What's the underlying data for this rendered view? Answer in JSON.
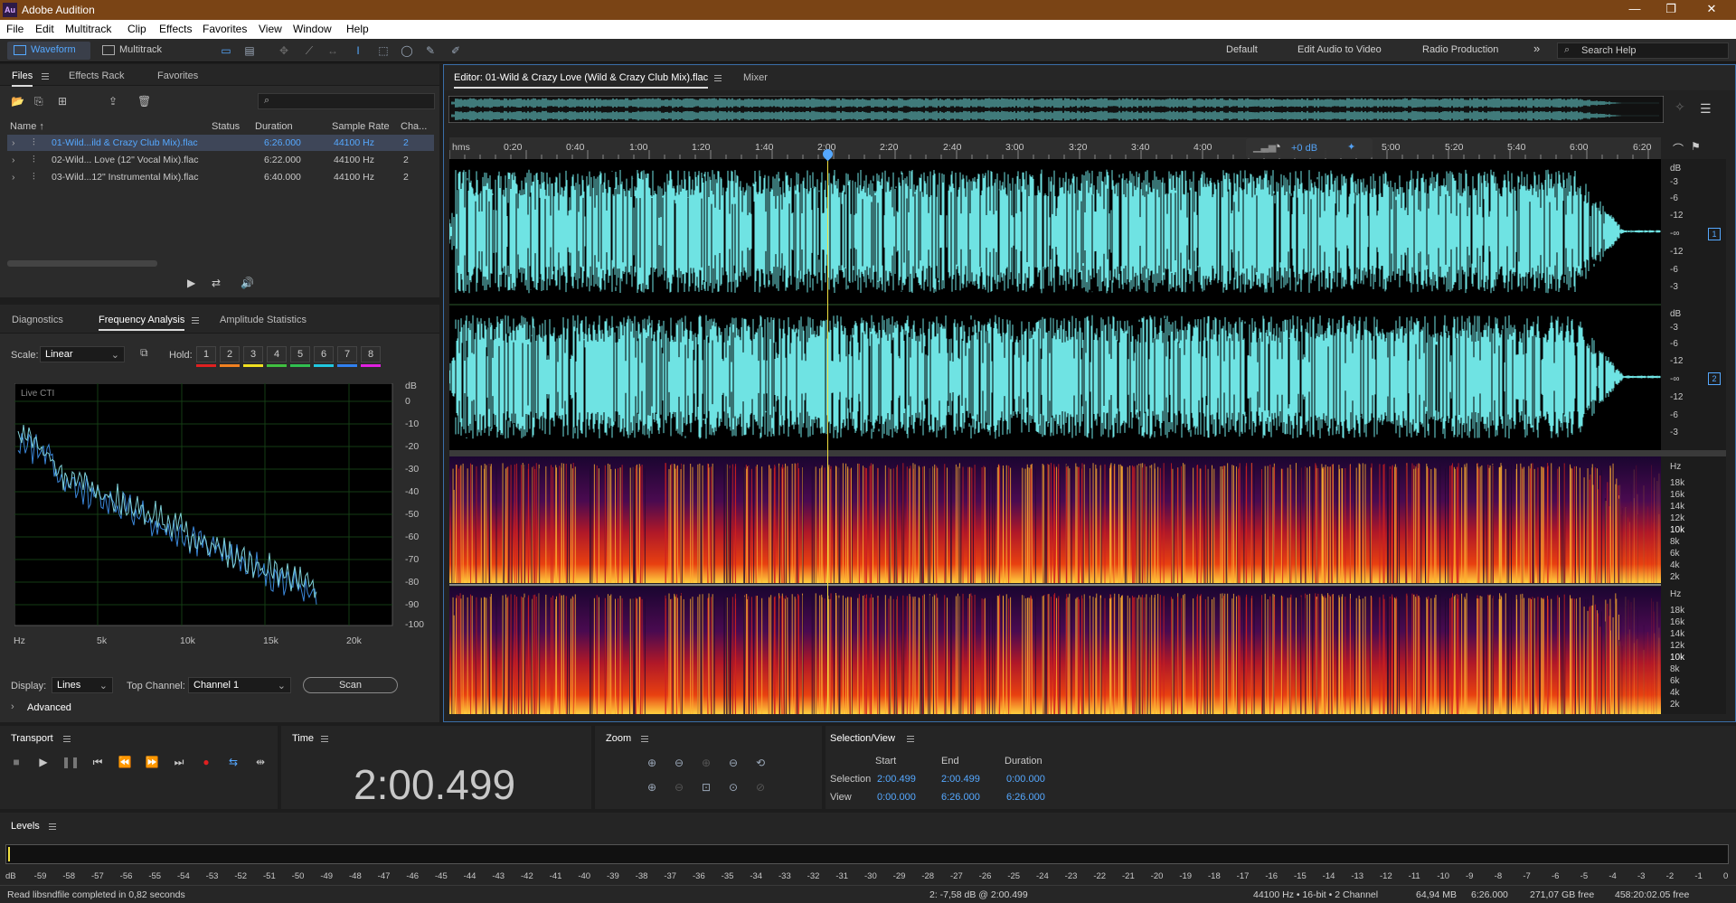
{
  "app": {
    "title": "Adobe Audition",
    "logo": "Au"
  },
  "window_controls": [
    "—",
    "❐",
    "✕"
  ],
  "menu": [
    "File",
    "Edit",
    "Multitrack",
    "Clip",
    "Effects",
    "Favorites",
    "View",
    "Window",
    "Help"
  ],
  "toolbar": {
    "modes": [
      "Waveform",
      "Multitrack"
    ],
    "workspaces": [
      "Default",
      "Edit Audio to Video",
      "Radio Production"
    ],
    "more": "»",
    "search_placeholder": "Search Help"
  },
  "files_panel": {
    "tabs": [
      "Files",
      "Effects Rack",
      "Favorites"
    ],
    "columns": [
      "Name ↑",
      "Status",
      "Duration",
      "Sample Rate",
      "Cha..."
    ],
    "rows": [
      {
        "name": "01-Wild...ild & Crazy Club Mix).flac",
        "duration": "6:26.000",
        "rate": "44100 Hz",
        "ch": "2",
        "selected": true
      },
      {
        "name": "02-Wild... Love (12\" Vocal Mix).flac",
        "duration": "6:22.000",
        "rate": "44100 Hz",
        "ch": "2",
        "selected": false
      },
      {
        "name": "03-Wild...12\" Instrumental Mix).flac",
        "duration": "6:40.000",
        "rate": "44100 Hz",
        "ch": "2",
        "selected": false
      }
    ]
  },
  "analysis_panel": {
    "tabs": [
      "Diagnostics",
      "Frequency Analysis",
      "Amplitude Statistics"
    ],
    "scale_label": "Scale:",
    "scale_value": "Linear",
    "hold_label": "Hold:",
    "hold_buttons": [
      "1",
      "2",
      "3",
      "4",
      "5",
      "6",
      "7",
      "8"
    ],
    "hold_colors": [
      "#e02020",
      "#f08020",
      "#f0e020",
      "#40c040",
      "#30c050",
      "#20c8e0",
      "#3080f0",
      "#e020e0"
    ],
    "graph_label": "Live CTI",
    "db_unit": "dB",
    "db_ticks": [
      "0",
      "-10",
      "-20",
      "-30",
      "-40",
      "-50",
      "-60",
      "-70",
      "-80",
      "-90",
      "-100"
    ],
    "freq_ticks": [
      "Hz",
      "5k",
      "10k",
      "15k",
      "20k"
    ],
    "display_label": "Display:",
    "display_value": "Lines",
    "top_channel_label": "Top Channel:",
    "top_channel_value": "Channel 1",
    "scan_label": "Scan",
    "advanced_label": "Advanced"
  },
  "editor": {
    "tab_title": "Editor: 01-Wild & Crazy Love (Wild & Crazy Club Mix).flac",
    "mixer_tab": "Mixer",
    "ruler_unit": "hms",
    "ruler_ticks": [
      "0:20",
      "0:40",
      "1:00",
      "1:20",
      "1:40",
      "2:00",
      "2:20",
      "2:40",
      "3:00",
      "3:20",
      "3:40",
      "4:00",
      "5:00",
      "5:20",
      "5:40",
      "6:00",
      "6:20"
    ],
    "gain_label": "+0 dB",
    "db_scale": [
      "dB",
      "-3",
      "-6",
      "-12",
      "-∞",
      "-12",
      "-6",
      "-3"
    ],
    "channel_badges": [
      "1",
      "2"
    ],
    "hz_scale": [
      "Hz",
      "18k",
      "16k",
      "14k",
      "12k",
      "10k",
      "8k",
      "6k",
      "4k",
      "2k"
    ]
  },
  "transport": {
    "title": "Transport"
  },
  "time": {
    "title": "Time",
    "value": "2:00.499"
  },
  "zoom": {
    "title": "Zoom"
  },
  "selection": {
    "title": "Selection/View",
    "headers": [
      "Start",
      "End",
      "Duration"
    ],
    "rows": [
      {
        "label": "Selection",
        "start": "2:00.499",
        "end": "2:00.499",
        "duration": "0:00.000"
      },
      {
        "label": "View",
        "start": "0:00.000",
        "end": "6:26.000",
        "duration": "6:26.000"
      }
    ]
  },
  "levels": {
    "title": "Levels",
    "ticks": [
      "dB",
      "-59",
      "-58",
      "-57",
      "-56",
      "-55",
      "-54",
      "-53",
      "-52",
      "-51",
      "-50",
      "-49",
      "-48",
      "-47",
      "-46",
      "-45",
      "-44",
      "-43",
      "-42",
      "-41",
      "-40",
      "-39",
      "-38",
      "-37",
      "-36",
      "-35",
      "-34",
      "-33",
      "-32",
      "-31",
      "-30",
      "-29",
      "-28",
      "-27",
      "-26",
      "-25",
      "-24",
      "-23",
      "-22",
      "-21",
      "-20",
      "-19",
      "-18",
      "-17",
      "-16",
      "-15",
      "-14",
      "-13",
      "-12",
      "-11",
      "-10",
      "-9",
      "-8",
      "-7",
      "-6",
      "-5",
      "-4",
      "-3",
      "-2",
      "-1",
      "0"
    ]
  },
  "status": {
    "message": "Read libsndfile completed in 0,82 seconds",
    "cursor": "2: -7,58 dB @ 2:00.499",
    "format": "44100 Hz • 16-bit • 2 Channel",
    "size": "64,94 MB",
    "duration": "6:26.000",
    "free_space": "271,07 GB free",
    "free_time": "458:20:02.05 free"
  },
  "colors": {
    "accent": "#55a8ff",
    "waveform": "#6fe3e3",
    "playhead": "#f0e040"
  }
}
